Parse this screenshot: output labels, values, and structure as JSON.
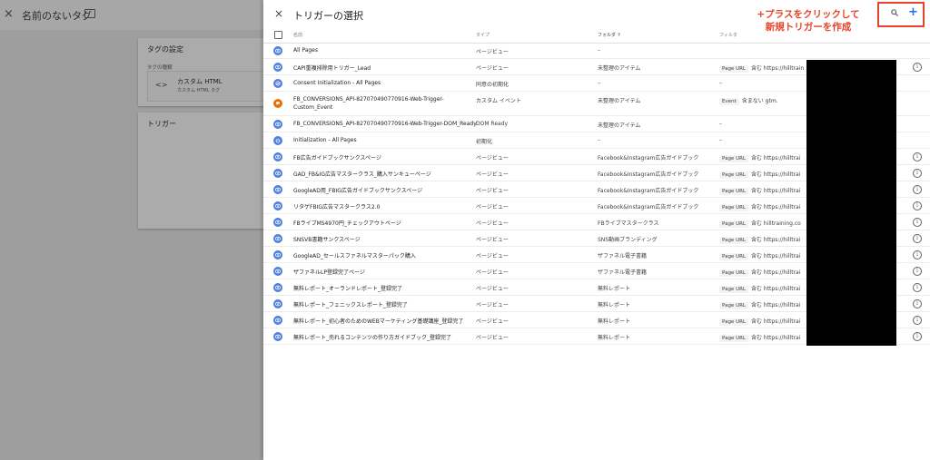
{
  "background": {
    "close": "×",
    "title": "名前のないタグ",
    "card1": {
      "title": "タグの設定",
      "sub": "タグの種類",
      "inner_title": "カスタム HTML",
      "inner_sub": "カスタム HTML タグ",
      "code": "<>"
    },
    "card2": {
      "title": "トリガー"
    }
  },
  "panel": {
    "close": "×",
    "title": "トリガーの選択",
    "annotation_line1": "+プラスをクリックして",
    "annotation_line2": "新規トリガーを作成",
    "plus": "+",
    "columns": {
      "name": "名前",
      "type": "タイプ",
      "folder": "フォルダ ↑",
      "filter": "フィルタ"
    }
  },
  "icon_colors": {
    "pageview": "#4e7fe2",
    "consent": "#5b7de0",
    "event": "#e8710a",
    "init": "#4e7fe2"
  },
  "annotation_color": "#e8432a",
  "rows": [
    {
      "icon": "eye",
      "color": "#4e7fe2",
      "name": "All Pages",
      "type": "ページビュー",
      "folder": "–",
      "filter_chip": "",
      "filter_text": "",
      "info": false
    },
    {
      "icon": "eye",
      "color": "#4e7fe2",
      "name": "CAPI重複排除用トリガー_Lead",
      "type": "ページビュー",
      "folder": "未整理のアイテム",
      "filter_chip": "Page URL",
      "filter_text": "含む https://hilltrain",
      "info": true
    },
    {
      "icon": "consent",
      "color": "#5b7de0",
      "name": "Consent Initialization - All Pages",
      "type": "同意の初期化",
      "folder": "–",
      "filter_chip": "",
      "filter_text": "–",
      "info": false
    },
    {
      "icon": "event",
      "color": "#e8710a",
      "name": "FB_CONVERSIONS_API-827070490770916-Web-Trigger-Custom_Event",
      "type": "カスタム イベント",
      "folder": "未整理のアイテム",
      "filter_chip": "Event",
      "filter_text": "含まない gtm.",
      "info": false,
      "tall": true
    },
    {
      "icon": "eye",
      "color": "#4e7fe2",
      "name": "FB_CONVERSIONS_API-827070490770916-Web-Trigger-DOM_Ready",
      "type": "DOM Ready",
      "folder": "未整理のアイテム",
      "filter_chip": "",
      "filter_text": "–",
      "info": false
    },
    {
      "icon": "init",
      "color": "#4e7fe2",
      "name": "Initialization - All Pages",
      "type": "初期化",
      "folder": "–",
      "filter_chip": "",
      "filter_text": "–",
      "info": false
    },
    {
      "icon": "eye",
      "color": "#4e7fe2",
      "name": "FB広告ガイドブックサンクスページ",
      "type": "ページビュー",
      "folder": "Facebook&Instagram広告ガイドブック",
      "filter_chip": "Page URL",
      "filter_text": "含む https://hilltrai",
      "info": true
    },
    {
      "icon": "eye",
      "color": "#4e7fe2",
      "name": "GAD_FB&IG広告マスタークラス_購入サンキューページ",
      "type": "ページビュー",
      "folder": "Facebook&Instagram広告ガイドブック",
      "filter_chip": "Page URL",
      "filter_text": "含む https://hilltrai",
      "info": true
    },
    {
      "icon": "eye",
      "color": "#4e7fe2",
      "name": "GoogleAD用_FBIG広告ガイドブックサンクスページ",
      "type": "ページビュー",
      "folder": "Facebook&Instagram広告ガイドブック",
      "filter_chip": "Page URL",
      "filter_text": "含む https://hilltrai",
      "info": true
    },
    {
      "icon": "eye",
      "color": "#4e7fe2",
      "name": "リタゲFBIG広告マスタークラス2.0",
      "type": "ページビュー",
      "folder": "Facebook&Instagram広告ガイドブック",
      "filter_chip": "Page URL",
      "filter_text": "含む https://hilltrai",
      "info": true
    },
    {
      "icon": "eye",
      "color": "#4e7fe2",
      "name": "FBライブMS4970円_チェックアウトページ",
      "type": "ページビュー",
      "folder": "FBライブマスタークラス",
      "filter_chip": "Page URL",
      "filter_text": "含む hilltraining.co",
      "info": true
    },
    {
      "icon": "eye",
      "color": "#4e7fe2",
      "name": "SNSVB書籍サンクスページ",
      "type": "ページビュー",
      "folder": "SNS動画ブランディング",
      "filter_chip": "Page URL",
      "filter_text": "含む https://hilltrai",
      "info": true
    },
    {
      "icon": "eye",
      "color": "#4e7fe2",
      "name": "GoogleAD_セールスファネルマスターパック購入",
      "type": "ページビュー",
      "folder": "ザファネル電子書籍",
      "filter_chip": "Page URL",
      "filter_text": "含む https://hilltrai",
      "info": true
    },
    {
      "icon": "eye",
      "color": "#4e7fe2",
      "name": "ザファネルLP登録完了ページ",
      "type": "ページビュー",
      "folder": "ザファネル電子書籍",
      "filter_chip": "Page URL",
      "filter_text": "含む https://hilltrai",
      "info": true
    },
    {
      "icon": "eye",
      "color": "#4e7fe2",
      "name": "無料レポート_オーランドレポート_登録完了",
      "type": "ページビュー",
      "folder": "無料レポート",
      "filter_chip": "Page URL",
      "filter_text": "含む https://hilltrai",
      "info": true
    },
    {
      "icon": "eye",
      "color": "#4e7fe2",
      "name": "無料レポート_フェニックスレポート_登録完了",
      "type": "ページビュー",
      "folder": "無料レポート",
      "filter_chip": "Page URL",
      "filter_text": "含む https://hilltrai",
      "info": true
    },
    {
      "icon": "eye",
      "color": "#4e7fe2",
      "name": "無料レポート_初心者のためのWEBマーケティング基礎講座_登録完了",
      "type": "ページビュー",
      "folder": "無料レポート",
      "filter_chip": "Page URL",
      "filter_text": "含む https://hilltrai",
      "info": true
    },
    {
      "icon": "eye",
      "color": "#4e7fe2",
      "name": "無料レポート_売れるコンテンツの作り方ガイドブック_登録完了",
      "type": "ページビュー",
      "folder": "無料レポート",
      "filter_chip": "Page URL",
      "filter_text": "含む https://hilltrai",
      "info": true
    }
  ]
}
